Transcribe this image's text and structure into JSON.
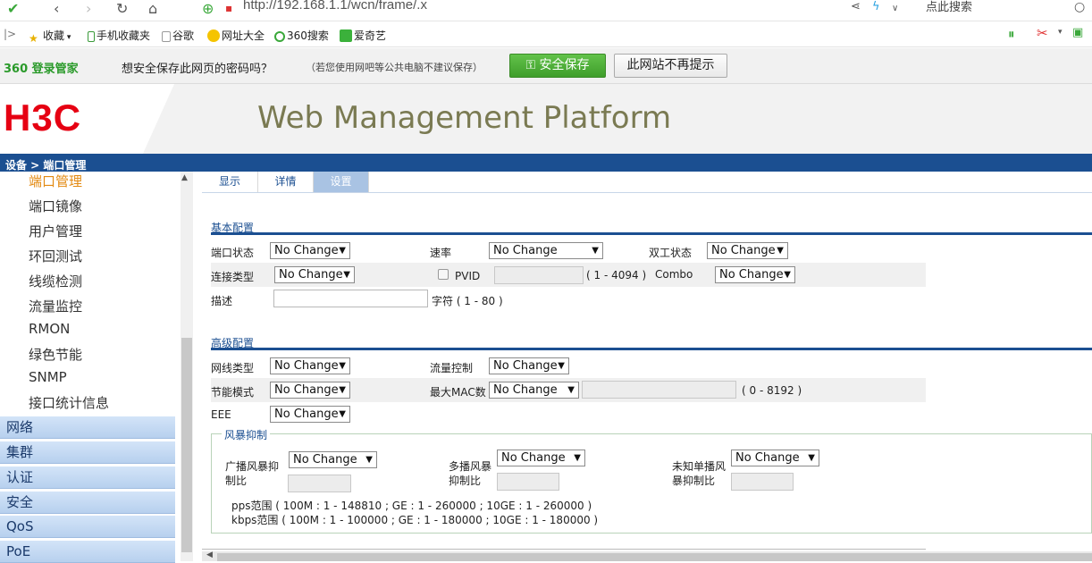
{
  "browser": {
    "url": "http://192.168.1.1/wcn/frame/.x",
    "search_placeholder": "点此搜索",
    "bookmarks": [
      "收藏",
      "手机收藏夹",
      "谷歌",
      "网址大全",
      "360搜索",
      "爱奇艺"
    ]
  },
  "password_bar": {
    "brand": "360 登录管家",
    "message": "想安全保存此网页的密码吗？",
    "sub": "（若您使用网吧等公共电脑不建议保存）",
    "save_label": "安全保存",
    "never_label": "此网站不再提示"
  },
  "header": {
    "logo": "H3C",
    "title": "Web Management Platform",
    "breadcrumb": "设备 > 端口管理"
  },
  "sidebar": {
    "sub_items": [
      "端口管理",
      "端口镜像",
      "用户管理",
      "环回测试",
      "线缆检测",
      "流量监控",
      "RMON",
      "绿色节能",
      "SNMP",
      "接口统计信息"
    ],
    "main_items": [
      "网络",
      "集群",
      "认证",
      "安全",
      "QoS",
      "PoE"
    ]
  },
  "tabs": [
    "显示",
    "详情",
    "设置"
  ],
  "basic": {
    "title": "基本配置",
    "port_state_label": "端口状态",
    "speed_label": "速率",
    "duplex_label": "双工状态",
    "link_type_label": "连接类型",
    "pvid_label": "PVID",
    "pvid_range": "( 1 - 4094 )",
    "combo_label": "Combo",
    "desc_label": "描述",
    "desc_range": "字符 ( 1 - 80 )",
    "no_change": "No Change"
  },
  "advanced": {
    "title": "高级配置",
    "mdi_label": "网线类型",
    "flow_label": "流量控制",
    "power_save_label": "节能模式",
    "max_mac_label": "最大MAC数",
    "max_mac_range": "( 0 - 8192 )",
    "eee_label": "EEE",
    "storm_title": "风暴抑制",
    "broadcast_label_1": "广播风暴抑",
    "broadcast_label_2": "制比",
    "multicast_label_1": "多播风暴",
    "multicast_label_2": "抑制比",
    "unknown_label_1": "未知单播风",
    "unknown_label_2": "暴抑制比",
    "pps_range": "pps范围 ( 100M : 1 - 148810 ; GE : 1 - 260000 ; 10GE : 1 - 260000 )",
    "kbps_range": "kbps范围 ( 100M : 1 - 100000 ; GE : 1 - 180000 ; 10GE : 1 - 180000 )"
  }
}
